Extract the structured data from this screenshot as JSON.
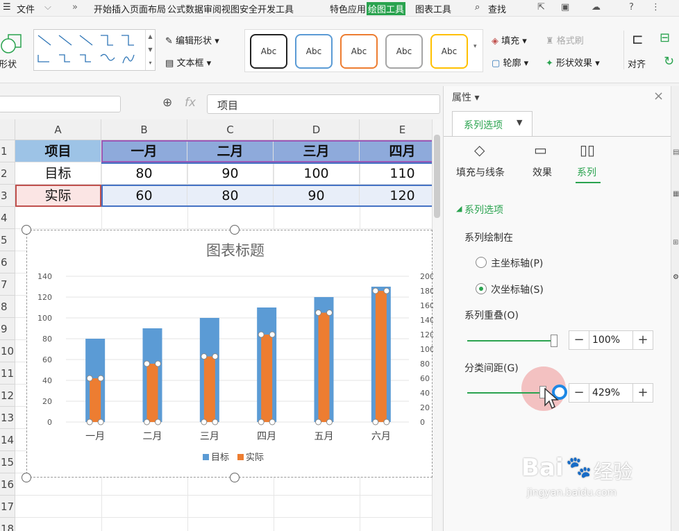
{
  "menubar": {
    "menu_icon": "hamburger-icon",
    "file": "文件",
    "more": "»",
    "tabs": [
      "开始",
      "插入",
      "页面布局",
      "公式",
      "数据",
      "审阅",
      "视图",
      "安全",
      "开发工具",
      "特色应用"
    ],
    "drawing_tools": "绘图工具",
    "chart_tools": "图表工具",
    "search": "查找",
    "help": "?"
  },
  "ribbon": {
    "shape_label": "形状",
    "edit_shape": "编辑形状",
    "text_box": "文本框",
    "style_label": "Abc",
    "fill": "填充",
    "outline": "轮廓",
    "format_painter": "格式刷",
    "shape_effects": "形状效果",
    "align": "对齐"
  },
  "formula": {
    "fx": "fx",
    "value": "项目"
  },
  "sheet": {
    "columns": [
      "A",
      "B",
      "C",
      "D",
      "E"
    ],
    "rows": [
      "1",
      "2",
      "3",
      "4",
      "5",
      "6",
      "7",
      "8",
      "9",
      "10",
      "11",
      "12",
      "13",
      "14",
      "15",
      "16",
      "17",
      "18"
    ],
    "header": [
      "项目",
      "一月",
      "二月",
      "三月",
      "四月"
    ],
    "row2": [
      "目标",
      "80",
      "90",
      "100",
      "110"
    ],
    "row3": [
      "实际",
      "60",
      "80",
      "90",
      "120"
    ]
  },
  "chart_data": {
    "type": "bar",
    "title": "图表标题",
    "categories": [
      "一月",
      "二月",
      "三月",
      "四月",
      "五月",
      "六月"
    ],
    "series": [
      {
        "name": "目标",
        "values": [
          80,
          90,
          100,
          110,
          120,
          130
        ],
        "color": "#5b9bd5",
        "axis": "primary"
      },
      {
        "name": "实际",
        "values": [
          60,
          80,
          90,
          120,
          150,
          180
        ],
        "color": "#ed7d31",
        "axis": "secondary"
      }
    ],
    "y_ticks": [
      "0",
      "20",
      "40",
      "60",
      "80",
      "100",
      "120",
      "140"
    ],
    "y2_ticks": [
      "0",
      "20",
      "40",
      "60",
      "80",
      "100",
      "120",
      "140",
      "160",
      "180",
      "200"
    ],
    "ylim": [
      0,
      140
    ],
    "y2lim": [
      0,
      200
    ],
    "legend": "bottom",
    "grid": true
  },
  "panel": {
    "title": "属性",
    "tab": "系列选项",
    "subtabs": [
      "填充与线条",
      "效果",
      "系列"
    ],
    "section": "系列选项",
    "plot_on": "系列绘制在",
    "primary_axis": "主坐标轴(P)",
    "secondary_axis": "次坐标轴(S)",
    "overlap_label": "系列重叠(O)",
    "overlap_value": "100%",
    "overlap_level": 1.0,
    "gap_label": "分类间距(G)",
    "gap_value": "429%",
    "gap_level": 0.86,
    "minus": "−",
    "plus": "+"
  },
  "watermark": {
    "brand": "Bai",
    "brand2": "经验",
    "url": "jingyan.baidu.com"
  }
}
